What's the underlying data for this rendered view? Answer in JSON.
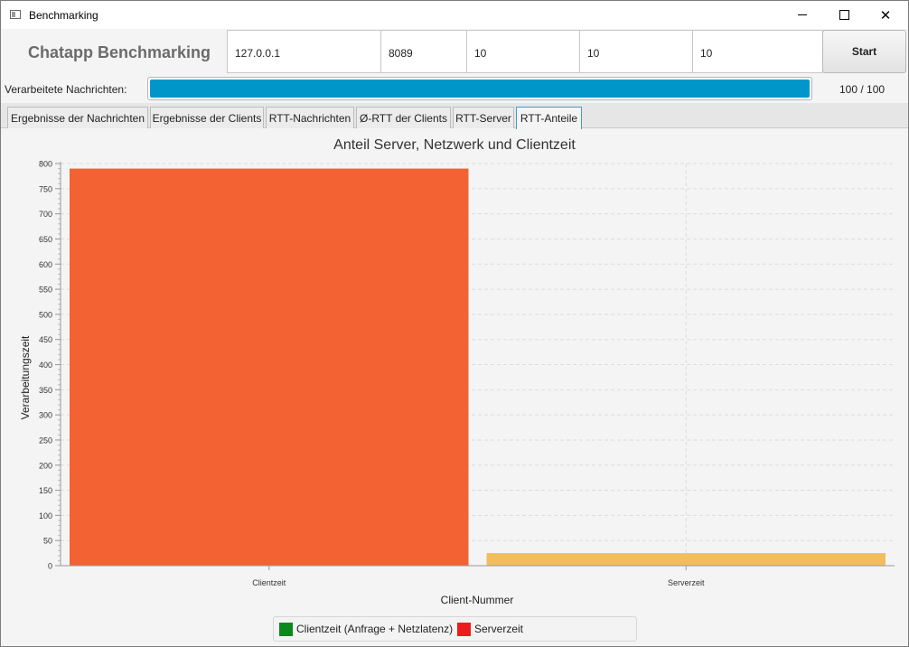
{
  "window": {
    "title": "Benchmarking",
    "icon": "window-icon",
    "controls": [
      "minimize-icon",
      "maximize-icon",
      "close-icon"
    ]
  },
  "toolbar": {
    "app_title": "Chatapp Benchmarking",
    "fields": [
      "127.0.0.1",
      "8089",
      "10",
      "10",
      "10"
    ],
    "start_label": "Start"
  },
  "progress": {
    "label": "Verarbeitete Nachrichten:",
    "fraction": 1.0,
    "count_text": "100 / 100",
    "color": "#0096c9"
  },
  "tabs": [
    {
      "label": "Ergebnisse der Nachrichten",
      "active": false
    },
    {
      "label": "Ergebnisse der Clients",
      "active": false
    },
    {
      "label": "RTT-Nachrichten",
      "active": false
    },
    {
      "label": "Ø-RTT der Clients",
      "active": false
    },
    {
      "label": "RTT-Server",
      "active": false
    },
    {
      "label": "RTT-Anteile",
      "active": true
    }
  ],
  "chart_data": {
    "type": "bar",
    "title": "Anteil Server, Netzwerk und Clientzeit",
    "xlabel": "Client-Nummer",
    "ylabel": "Verarbeitungszeit",
    "categories": [
      "Clientzeit",
      "Serverzeit"
    ],
    "values": [
      790,
      25
    ],
    "bar_colors": [
      "#f26233",
      "#f3bc5e"
    ],
    "ylim": [
      0,
      800
    ],
    "yticks": [
      0,
      50,
      100,
      150,
      200,
      250,
      300,
      350,
      400,
      450,
      500,
      550,
      600,
      650,
      700,
      750,
      800
    ],
    "grid": true,
    "legend": [
      {
        "label": "Clientzeit (Anfrage + Netzlatenz)",
        "color": "#0b8a1b"
      },
      {
        "label": "Serverzeit",
        "color": "#ee1c1c"
      }
    ],
    "legend_position": "bottom"
  }
}
